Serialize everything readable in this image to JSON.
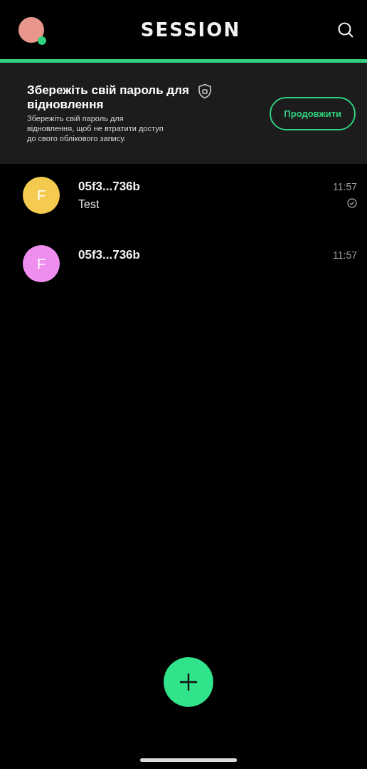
{
  "header": {
    "title": "SESSION"
  },
  "banner": {
    "title": "Збережіть свій пароль для відновлення",
    "text": "Збережіть свій пароль для відновлення, щоб не втратити доступ до свого облікового запису.",
    "button": "Продовжити"
  },
  "conversations": [
    {
      "letter": "F",
      "name": "05f3...736b",
      "preview": "Test",
      "time": "11:57",
      "color": "#f5cb4f",
      "delivered": true
    },
    {
      "letter": "F",
      "name": "05f3...736b",
      "time": "11:57",
      "color": "#f08ef0",
      "delivered": false
    }
  ]
}
